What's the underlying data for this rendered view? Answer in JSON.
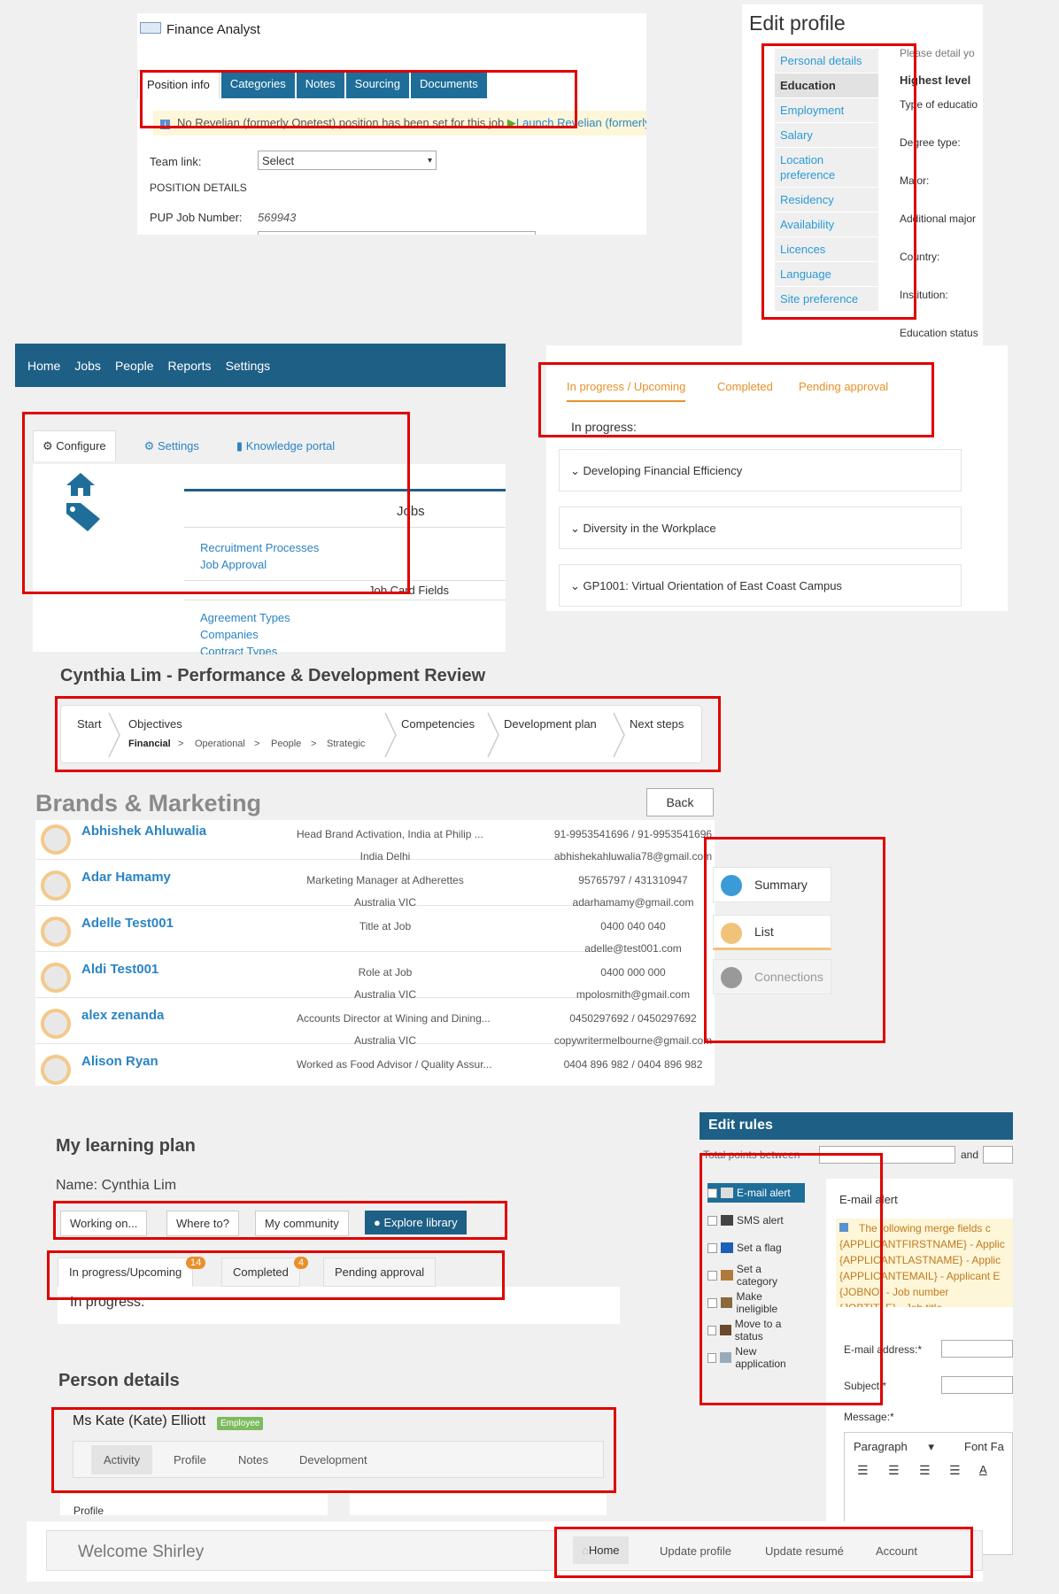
{
  "panel1": {
    "title": "Finance Analyst",
    "tabs": [
      "Position info",
      "Categories",
      "Notes",
      "Sourcing",
      "Documents"
    ],
    "notice_text": "No Revelian (formerly Onetest) position has been set for this job",
    "notice_link": "Launch Revelian (formerly Onetes",
    "team_link_label": "Team link:",
    "team_link_value": "Select",
    "position_details": "POSITION DETAILS",
    "pup_label": "PUP Job Number:",
    "pup_value": "569943"
  },
  "edit_profile": {
    "title": "Edit profile",
    "menu": [
      "Personal details",
      "Education",
      "Employment",
      "Salary",
      "Location preference",
      "Residency",
      "Availability",
      "Licences",
      "Language",
      "Site preference"
    ],
    "intro": "Please detail yo",
    "heading": "Highest level",
    "fields": [
      "Type of educatio",
      "Degree type:",
      "Major:",
      "Additional major",
      "Country:",
      "Institution:",
      "Education status"
    ]
  },
  "topnav": {
    "items": [
      "Home",
      "Jobs",
      "People",
      "Reports",
      "Settings"
    ]
  },
  "configure": {
    "tabs": [
      "Configure",
      "Settings",
      "Knowledge portal"
    ],
    "section": "Jobs",
    "links1": [
      "Recruitment Processes",
      "Job Approval"
    ],
    "subsection": "Job Card Fields",
    "links2": [
      "Agreement Types",
      "Companies",
      "Contract Types"
    ]
  },
  "learning_tabs": {
    "tabs": [
      "In progress / Upcoming",
      "Completed",
      "Pending approval"
    ],
    "in_progress": "In progress:",
    "courses": [
      "Developing Financial Efficiency",
      "Diversity in the Workplace",
      "GP1001: Virtual Orientation of East Coast Campus"
    ]
  },
  "review": {
    "title": "Cynthia Lim - Performance & Development Review",
    "steps": [
      "Start",
      "Objectives",
      "Competencies",
      "Development plan",
      "Next steps"
    ],
    "substeps": [
      "Financial",
      "Operational",
      "People",
      "Strategic"
    ],
    "sep": ">"
  },
  "brands": {
    "title": "Brands & Marketing",
    "back": "Back",
    "contacts": [
      {
        "name": "Abhishek Ahluwalia",
        "role": "Head Brand Activation, India at Philip ...",
        "location": "India Delhi",
        "phone": "91-9953541696 / 91-9953541696",
        "email": "abhishekahluwalia78@gmail.com"
      },
      {
        "name": "Adar Hamamy",
        "role": "Marketing Manager at Adherettes",
        "location": "Australia VIC",
        "phone": "95765797 / 431310947",
        "email": "adarhamamy@gmail.com"
      },
      {
        "name": "Adelle Test001",
        "role": "Title at Job",
        "location": "",
        "phone": "0400 040 040",
        "email": "adelle@test001.com"
      },
      {
        "name": "Aldi Test001",
        "role": "Role at Job",
        "location": "Australia VIC",
        "phone": "0400 000 000",
        "email": "mpolosmith@gmail.com"
      },
      {
        "name": "alex zenanda",
        "role": "Accounts Director at Wining and Dining...",
        "location": "Australia VIC",
        "phone": "0450297692 / 0450297692",
        "email": "copywritermelbourne@gmail.com"
      },
      {
        "name": "Alison Ryan",
        "role": "Worked as Food Advisor / Quality Assur...",
        "location": "",
        "phone": "0404 896 982 / 0404 896 982",
        "email": ""
      }
    ],
    "side": [
      "Summary",
      "List",
      "Connections"
    ]
  },
  "learning_plan": {
    "title": "My learning plan",
    "name": "Name: Cynthia Lim",
    "buttons": [
      "Working on...",
      "Where to?",
      "My community",
      "Explore library"
    ],
    "tabs": [
      "In progress/Upcoming",
      "Completed",
      "Pending approval"
    ],
    "badges": [
      "14",
      "4"
    ],
    "in_progress": "In progress:"
  },
  "edit_rules": {
    "title": "Edit rules",
    "total_points": "Total points between",
    "and": "and",
    "items": [
      "E-mail alert",
      "SMS alert",
      "Set a flag",
      "Set a category",
      "Make ineligible",
      "Move to a status",
      "New application"
    ],
    "panel_title": "E-mail alert",
    "info_lines": [
      "The following merge fields c",
      "{APPLICANTFIRSTNAME} - Applic",
      "{APPLICANTLASTNAME} - Applic",
      "{APPLICANTEMAIL} - Applicant E",
      "{JOBNO} - Job number",
      "{JOBTITLE} - Job title"
    ],
    "email_label": "E-mail address:*",
    "subject_label": "Subject:*",
    "message_label": "Message:*",
    "paragraph": "Paragraph",
    "font": "Font Fa"
  },
  "person": {
    "title": "Person details",
    "name": "Ms Kate (Kate) Elliott",
    "tag": "Employee",
    "tabs": [
      "Activity",
      "Profile",
      "Notes",
      "Development"
    ],
    "profile": "Profile"
  },
  "welcome": {
    "text": "Welcome Shirley",
    "nav": [
      "Home",
      "Update profile",
      "Update resumé",
      "Account"
    ]
  },
  "colors": {
    "accent": "#1e5f86",
    "highlight": "#e00000",
    "link": "#2a84c4"
  }
}
